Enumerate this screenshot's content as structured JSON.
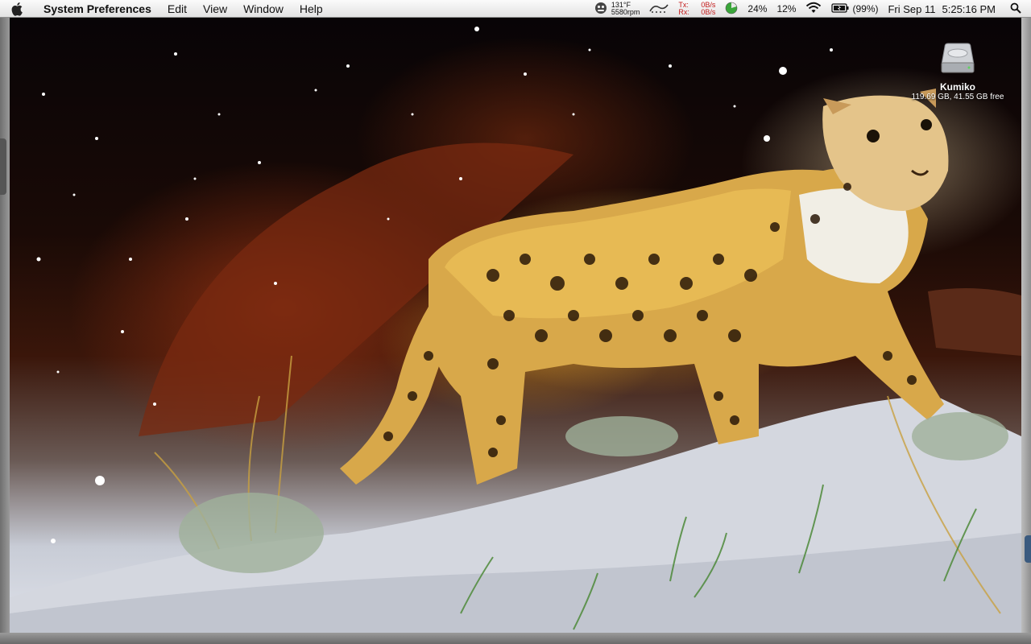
{
  "menubar": {
    "app_name": "System Preferences",
    "menus": [
      "Edit",
      "View",
      "Window",
      "Help"
    ],
    "status": {
      "temperature": "131°F",
      "fan_speed": "5580rpm",
      "tx_label": "Tx:",
      "rx_label": "Rx:",
      "tx_value": "0B/s",
      "rx_value": "0B/s",
      "cpu_percent": "24%",
      "disk_percent": "12%",
      "battery": "(99%)",
      "date": "Fri Sep 11",
      "time": "5:25:16 PM"
    },
    "icons": [
      "apple-icon",
      "monitor-face-icon",
      "activity-icon",
      "pie-chart-icon",
      "wifi-icon",
      "battery-icon",
      "spotlight-icon"
    ]
  },
  "desktop": {
    "wallpaper": "snow leopard",
    "drive": {
      "name": "Kumiko",
      "info": "119.69 GB, 41.55 GB free"
    }
  },
  "colors": {
    "menubar_bg": "#ececec",
    "net_text": "#c21a1a"
  }
}
